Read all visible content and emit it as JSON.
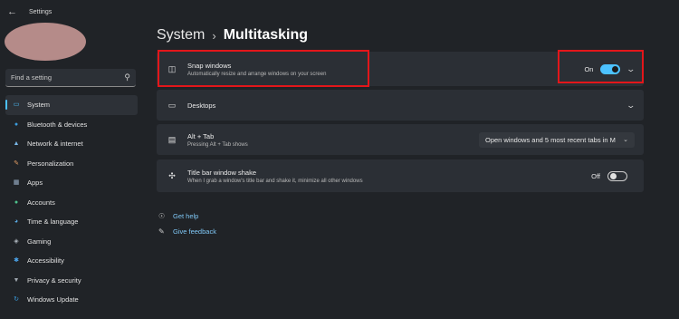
{
  "window": {
    "title": "Settings",
    "back_icon": "back-arrow-icon"
  },
  "search": {
    "placeholder": "Find a setting"
  },
  "sidebar": {
    "items": [
      {
        "label": "System",
        "icon": "monitor-icon",
        "active": true,
        "color": "#4cc2ff"
      },
      {
        "label": "Bluetooth & devices",
        "icon": "bluetooth-icon",
        "color": "#3a9bdc"
      },
      {
        "label": "Network & internet",
        "icon": "wifi-icon",
        "color": "#7ab8e8"
      },
      {
        "label": "Personalization",
        "icon": "brush-icon",
        "color": "#e8a066"
      },
      {
        "label": "Apps",
        "icon": "apps-icon",
        "color": "#9ab0c8"
      },
      {
        "label": "Accounts",
        "icon": "person-icon",
        "color": "#4dc28c"
      },
      {
        "label": "Time & language",
        "icon": "globe-clock-icon",
        "color": "#58a8e0"
      },
      {
        "label": "Gaming",
        "icon": "gamepad-icon",
        "color": "#b0b8c0"
      },
      {
        "label": "Accessibility",
        "icon": "accessibility-icon",
        "color": "#4ca8f0"
      },
      {
        "label": "Privacy & security",
        "icon": "shield-icon",
        "color": "#a0a8b0"
      },
      {
        "label": "Windows Update",
        "icon": "update-icon",
        "color": "#3a9bdc"
      }
    ]
  },
  "header": {
    "parent": "System",
    "separator": "›",
    "current": "Multitasking"
  },
  "settings": {
    "snap": {
      "title": "Snap windows",
      "subtitle": "Automatically resize and arrange windows on your screen",
      "state": "On"
    },
    "desktops": {
      "title": "Desktops"
    },
    "alt_tab": {
      "title": "Alt + Tab",
      "subtitle": "Pressing Alt + Tab shows",
      "value": "Open windows and 5 most recent tabs in M"
    },
    "shake": {
      "title": "Title bar window shake",
      "subtitle": "When I grab a window's title bar and shake it, minimize all other windows",
      "state": "Off"
    }
  },
  "links": {
    "help": "Get help",
    "feedback": "Give feedback"
  },
  "colors": {
    "accent": "#4cc2ff",
    "highlight": "#e3161a",
    "link": "#7fc7f5"
  }
}
